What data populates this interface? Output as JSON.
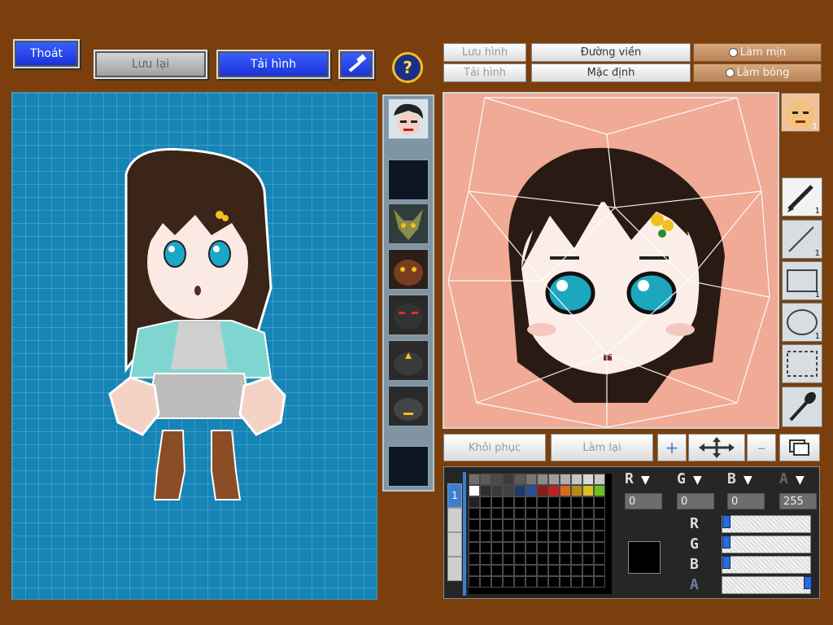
{
  "toolbar": {
    "exit": "Thoát",
    "save": "Lưu lại",
    "load": "Tải hình",
    "hammer_icon": "hammer-icon",
    "help_icon": "question-icon"
  },
  "editor_bar": {
    "save_image": "Lưu hình",
    "load_image": "Tải hình",
    "outline": "Đường viền",
    "default": "Mặc định",
    "smooth": "Làm mịn",
    "shine": "Làm bóng"
  },
  "edit_buttons": {
    "restore": "Khôi phục",
    "redo": "Làm lại"
  },
  "tools": {
    "pen_count": "1",
    "line_count": "1",
    "rect_count": "1",
    "ellipse_count": "1",
    "avatar_count": "1"
  },
  "color": {
    "labels": [
      "R",
      "G",
      "B",
      "A"
    ],
    "values": [
      "0",
      "0",
      "0",
      "255"
    ],
    "sliders": [
      0,
      0,
      0,
      100
    ],
    "current": "#000000"
  },
  "palette": {
    "tab": "1",
    "colors": [
      "#6e6e6e",
      "#5b5b5b",
      "#4b4b4b",
      "#3c3c3c",
      "#5a5a5a",
      "#777777",
      "#8b8b8b",
      "#9d9d9d",
      "#b0b0b0",
      "#c6c6c6",
      "#d8d8d8",
      "#c8c8c8",
      "#ffffff",
      "#2f2f2f",
      "#3a3a3a",
      "#424242",
      "#1c3a6e",
      "#2a4f93",
      "#8c1a1a",
      "#c41e1e",
      "#d86a1a",
      "#b98a17",
      "#e0c020",
      "#6bc01e",
      "#222222"
    ]
  }
}
